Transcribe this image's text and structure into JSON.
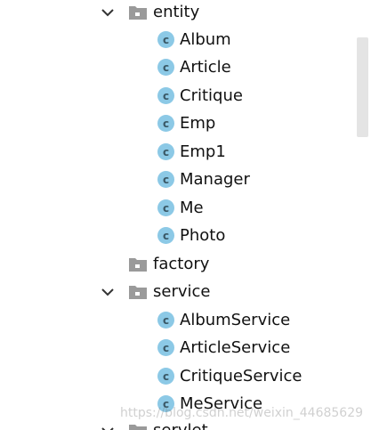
{
  "project_tree": {
    "entity": {
      "label": "entity",
      "children": [
        "Album",
        "Article",
        "Critique",
        "Emp",
        "Emp1",
        "Manager",
        "Me",
        "Photo"
      ]
    },
    "factory": {
      "label": "factory"
    },
    "service": {
      "label": "service",
      "children": [
        "AlbumService",
        "ArticleService",
        "CritiqueService",
        "MeService"
      ]
    },
    "servlet": {
      "label": "servlet"
    }
  },
  "class_icon_letter": "c",
  "watermark": "https://blog.csdn.net/weixin_44685629",
  "colors": {
    "class_icon_bg": "#8cc9e6",
    "folder_icon": "#9a9a9a",
    "chevron": "#333333"
  },
  "icons": {
    "expanded": "chevron-down-icon",
    "package": "package-folder-icon",
    "class": "class-icon"
  }
}
